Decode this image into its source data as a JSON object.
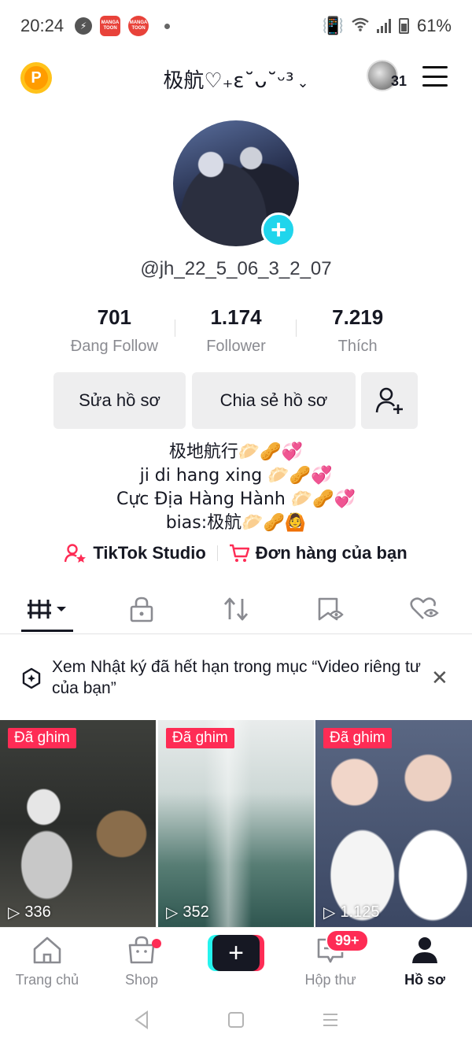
{
  "status_bar": {
    "time": "20:24",
    "messenger_icon": "messenger-icon",
    "app1": "MANGA TOON",
    "app2": "MANGA TOON",
    "battery": "61%"
  },
  "header": {
    "coin_label": "P",
    "username": "极航♡₊ɛ˘ᴗ˘ᵕ³",
    "story_count": "31"
  },
  "profile": {
    "handle": "@jh_22_5_06_3_2_07"
  },
  "stats": [
    {
      "value": "701",
      "label": "Đang Follow"
    },
    {
      "value": "1.174",
      "label": "Follower"
    },
    {
      "value": "7.219",
      "label": "Thích"
    }
  ],
  "actions": {
    "edit": "Sửa hồ sơ",
    "share": "Chia sẻ hồ sơ"
  },
  "bio": [
    "极地航行🥟🥜💞",
    "ji di hang xing 🥟🥜💞",
    "Cực Địa Hàng Hành 🥟🥜💞",
    "bias:极航🥟🥜🙆"
  ],
  "links": {
    "studio": "TikTok Studio",
    "orders": "Đơn hàng của bạn"
  },
  "notice": {
    "text": "Xem Nhật ký đã hết hạn trong mục “Video riêng tư của bạn”"
  },
  "videos": [
    {
      "badge": "Đã ghim",
      "views": "336"
    },
    {
      "badge": "Đã ghim",
      "views": "352"
    },
    {
      "badge": "Đã ghim",
      "views": "1.125"
    }
  ],
  "bottom_nav": {
    "home": "Trang chủ",
    "shop": "Shop",
    "inbox": "Hộp thư",
    "inbox_badge": "99+",
    "profile": "Hồ sơ"
  },
  "colors": {
    "accent": "#fe2c55",
    "cyan": "#25f4ee",
    "text": "#161823",
    "muted": "#8a8b91"
  }
}
